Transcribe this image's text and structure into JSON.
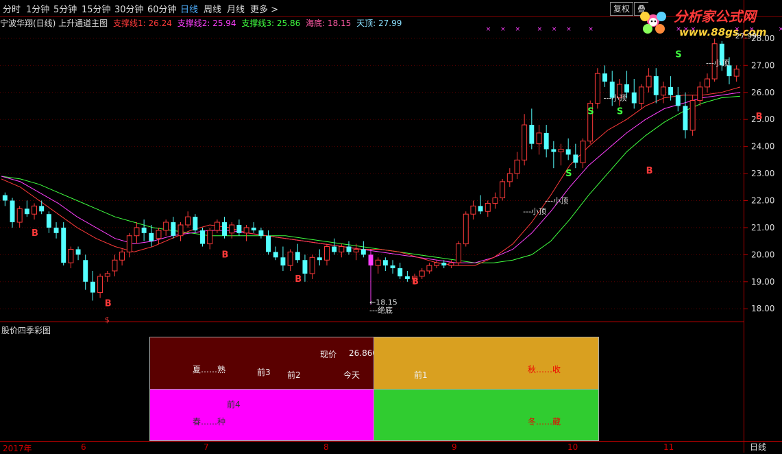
{
  "toolbar": {
    "periods": [
      "分时",
      "1分钟",
      "5分钟",
      "15分钟",
      "30分钟",
      "60分钟",
      "日线",
      "周线",
      "月线",
      "更多 >"
    ],
    "active": "日线",
    "fuquan_label": "复权",
    "cut_label": "叠",
    "logo_text": "分析家公式网",
    "logo_url_text": "www.88gs.com"
  },
  "info": {
    "stock_title": "宁波华翔(日线) 上升通道主图",
    "zc1": "支撑线1: 26.24",
    "zc2": "支撑线2: 25.94",
    "zc3": "支撑线3: 25.86",
    "haidi": "海底: 18.15",
    "tianding": "天顶: 27.99"
  },
  "colors": {
    "up": "#ff3a3a",
    "down": "#54ffff",
    "ma1": "#ff3a3a",
    "ma2": "#ff40ff",
    "ma3": "#40ff40",
    "grid_red": "#b00000"
  },
  "chart_data": {
    "type": "candlestick",
    "ylim": [
      17.6,
      28.2
    ],
    "yticks": [
      "28.00",
      "27.00",
      "26.00",
      "25.00",
      "24.00",
      "23.00",
      "22.00",
      "21.00",
      "20.00",
      "19.00",
      "18.00"
    ],
    "xlabels": [
      "2017年",
      "6",
      "7",
      "8",
      "9",
      "10",
      "11"
    ],
    "ma1": [
      22.8,
      22.5,
      22.0,
      21.5,
      21.0,
      20.6,
      20.3,
      20.1,
      20.3,
      20.6,
      20.9,
      21.1,
      21.0,
      20.8,
      20.7,
      20.6,
      20.5,
      20.4,
      20.3,
      20.2,
      20.2,
      20.1,
      19.9,
      19.7,
      19.6,
      19.6,
      19.9,
      20.4,
      21.2,
      22.2,
      23.3,
      24.0,
      24.6,
      25.0,
      25.5,
      25.8,
      25.9,
      25.9,
      26.0,
      26.2
    ],
    "ma2": [
      22.9,
      22.7,
      22.3,
      21.9,
      21.4,
      21.0,
      20.6,
      20.4,
      20.5,
      20.7,
      20.8,
      20.9,
      20.9,
      20.8,
      20.7,
      20.6,
      20.5,
      20.4,
      20.3,
      20.2,
      20.1,
      20.0,
      19.9,
      19.8,
      19.7,
      19.7,
      19.9,
      20.2,
      20.8,
      21.6,
      22.5,
      23.3,
      23.9,
      24.5,
      25.0,
      25.4,
      25.6,
      25.8,
      25.9,
      26.0
    ],
    "ma3": [
      22.9,
      22.8,
      22.6,
      22.3,
      22.0,
      21.7,
      21.4,
      21.2,
      21.0,
      20.9,
      20.8,
      20.7,
      20.7,
      20.7,
      20.7,
      20.7,
      20.6,
      20.5,
      20.4,
      20.3,
      20.2,
      20.1,
      20.0,
      19.9,
      19.8,
      19.7,
      19.7,
      19.8,
      20.0,
      20.5,
      21.3,
      22.2,
      23.0,
      23.8,
      24.4,
      24.9,
      25.3,
      25.6,
      25.8,
      25.86
    ],
    "candles": [
      [
        22.2,
        22.3,
        21.8,
        22.0
      ],
      [
        22.0,
        22.1,
        21.0,
        21.2
      ],
      [
        21.2,
        21.8,
        21.0,
        21.7
      ],
      [
        21.7,
        22.0,
        21.4,
        21.5
      ],
      [
        21.5,
        21.9,
        21.3,
        21.8
      ],
      [
        21.8,
        22.0,
        21.5,
        21.6
      ],
      [
        21.5,
        21.6,
        20.8,
        21.0
      ],
      [
        21.0,
        21.2,
        20.6,
        20.8
      ],
      [
        21.0,
        21.2,
        19.6,
        19.7
      ],
      [
        19.7,
        20.3,
        19.5,
        20.2
      ],
      [
        20.2,
        20.3,
        19.8,
        20.0
      ],
      [
        19.8,
        20.0,
        18.7,
        19.0
      ],
      [
        19.0,
        19.4,
        18.3,
        18.6
      ],
      [
        18.6,
        19.3,
        18.4,
        19.2
      ],
      [
        19.2,
        19.4,
        19.0,
        19.3
      ],
      [
        19.4,
        20.0,
        19.2,
        19.8
      ],
      [
        19.8,
        20.2,
        19.6,
        20.1
      ],
      [
        20.1,
        20.8,
        19.9,
        20.7
      ],
      [
        20.7,
        21.2,
        20.4,
        21.0
      ],
      [
        21.0,
        21.3,
        20.5,
        20.8
      ],
      [
        20.8,
        21.1,
        20.3,
        20.5
      ],
      [
        20.6,
        21.0,
        20.4,
        20.9
      ],
      [
        20.9,
        21.3,
        20.7,
        21.2
      ],
      [
        21.2,
        21.4,
        20.6,
        20.7
      ],
      [
        20.7,
        21.2,
        20.5,
        21.1
      ],
      [
        21.1,
        21.6,
        21.0,
        21.4
      ],
      [
        21.4,
        21.5,
        20.8,
        20.9
      ],
      [
        20.9,
        21.0,
        20.3,
        20.4
      ],
      [
        20.4,
        21.0,
        20.2,
        20.9
      ],
      [
        20.9,
        21.3,
        20.8,
        21.2
      ],
      [
        21.2,
        21.4,
        20.6,
        20.7
      ],
      [
        20.8,
        21.2,
        20.6,
        21.1
      ],
      [
        21.1,
        21.3,
        20.7,
        20.8
      ],
      [
        20.8,
        21.1,
        20.5,
        21.0
      ],
      [
        21.0,
        21.2,
        20.8,
        20.9
      ],
      [
        20.9,
        21.0,
        20.6,
        20.7
      ],
      [
        20.7,
        20.9,
        20.0,
        20.1
      ],
      [
        20.1,
        20.3,
        19.8,
        19.9
      ],
      [
        19.9,
        20.3,
        19.4,
        19.6
      ],
      [
        19.6,
        20.2,
        19.4,
        20.1
      ],
      [
        20.1,
        20.4,
        19.7,
        19.8
      ],
      [
        19.8,
        20.0,
        19.0,
        19.3
      ],
      [
        19.3,
        20.0,
        19.1,
        19.9
      ],
      [
        19.9,
        20.2,
        19.6,
        19.8
      ],
      [
        19.8,
        20.4,
        19.6,
        20.3
      ],
      [
        20.3,
        20.6,
        20.0,
        20.1
      ],
      [
        20.1,
        20.4,
        19.9,
        20.3
      ],
      [
        20.3,
        20.5,
        20.0,
        20.1
      ],
      [
        20.1,
        20.4,
        19.8,
        20.2
      ],
      [
        20.2,
        20.5,
        19.9,
        20.0
      ],
      [
        20.0,
        20.2,
        18.15,
        19.6
      ],
      [
        19.6,
        19.9,
        19.3,
        19.8
      ],
      [
        19.8,
        19.9,
        19.4,
        19.6
      ],
      [
        19.6,
        19.8,
        19.3,
        19.5
      ],
      [
        19.5,
        19.7,
        19.1,
        19.2
      ],
      [
        19.2,
        19.4,
        19.0,
        19.1
      ],
      [
        19.1,
        19.3,
        18.9,
        19.2
      ],
      [
        19.2,
        19.5,
        19.1,
        19.4
      ],
      [
        19.4,
        19.7,
        19.3,
        19.6
      ],
      [
        19.6,
        19.8,
        19.5,
        19.7
      ],
      [
        19.7,
        19.8,
        19.5,
        19.6
      ],
      [
        19.6,
        19.8,
        19.5,
        19.7
      ],
      [
        19.7,
        20.5,
        19.6,
        20.4
      ],
      [
        20.4,
        21.6,
        20.3,
        21.5
      ],
      [
        21.5,
        22.0,
        21.3,
        21.8
      ],
      [
        21.8,
        22.2,
        21.5,
        21.6
      ],
      [
        21.6,
        22.0,
        21.4,
        21.9
      ],
      [
        21.9,
        22.3,
        21.7,
        22.1
      ],
      [
        22.1,
        22.8,
        22.0,
        22.7
      ],
      [
        22.7,
        23.2,
        22.5,
        23.0
      ],
      [
        23.0,
        23.8,
        22.8,
        23.5
      ],
      [
        23.5,
        25.2,
        23.3,
        24.8
      ],
      [
        24.8,
        25.4,
        23.9,
        24.1
      ],
      [
        24.1,
        24.8,
        23.7,
        24.5
      ],
      [
        24.5,
        24.8,
        23.6,
        23.9
      ],
      [
        23.9,
        24.2,
        23.2,
        23.8
      ],
      [
        23.8,
        24.1,
        23.3,
        23.9
      ],
      [
        23.9,
        24.3,
        23.5,
        23.7
      ],
      [
        23.7,
        24.1,
        23.2,
        23.4
      ],
      [
        23.4,
        24.3,
        23.2,
        24.2
      ],
      [
        24.2,
        25.7,
        24.1,
        25.6
      ],
      [
        25.6,
        26.9,
        25.4,
        26.7
      ],
      [
        26.7,
        27.0,
        26.2,
        26.4
      ],
      [
        26.4,
        26.8,
        25.5,
        25.8
      ],
      [
        25.8,
        26.5,
        25.5,
        26.3
      ],
      [
        26.3,
        26.8,
        25.8,
        26.0
      ],
      [
        26.0,
        26.5,
        25.4,
        25.6
      ],
      [
        25.6,
        26.3,
        25.4,
        26.2
      ],
      [
        26.2,
        26.9,
        26.0,
        26.6
      ],
      [
        26.6,
        26.9,
        25.6,
        25.9
      ],
      [
        25.9,
        26.4,
        25.6,
        26.2
      ],
      [
        26.2,
        26.6,
        25.7,
        25.9
      ],
      [
        25.9,
        26.2,
        25.3,
        25.5
      ],
      [
        25.5,
        26.0,
        24.3,
        24.6
      ],
      [
        24.6,
        25.9,
        24.4,
        25.7
      ],
      [
        25.7,
        26.4,
        25.5,
        26.2
      ],
      [
        26.2,
        26.7,
        26.0,
        26.5
      ],
      [
        26.5,
        27.99,
        26.4,
        27.8
      ],
      [
        27.8,
        27.9,
        26.8,
        27.0
      ],
      [
        27.0,
        27.3,
        26.3,
        26.6
      ],
      [
        26.6,
        27.0,
        26.4,
        26.86
      ]
    ],
    "signals": [
      {
        "text": "B",
        "color": "#ff3a3a",
        "i": 4,
        "price": 20.7
      },
      {
        "text": "B",
        "color": "#ff3a3a",
        "i": 14,
        "price": 18.1
      },
      {
        "text": "B",
        "color": "#ff3a3a",
        "i": 30,
        "price": 19.9
      },
      {
        "text": "B",
        "color": "#ff3a3a",
        "i": 40,
        "price": 19.0
      },
      {
        "text": "B",
        "color": "#ff3a3a",
        "i": 56,
        "price": 18.9
      },
      {
        "text": "S",
        "color": "#40ff40",
        "i": 77,
        "price": 22.9
      },
      {
        "text": "S",
        "color": "#40ff40",
        "i": 80,
        "price": 25.2
      },
      {
        "text": "S",
        "color": "#40ff40",
        "i": 84,
        "price": 25.2
      },
      {
        "text": "B",
        "color": "#ff3a3a",
        "i": 88,
        "price": 23.0
      },
      {
        "text": "S",
        "color": "#40ff40",
        "i": 92,
        "price": 27.3
      },
      {
        "text": "B",
        "color": "#ff3a3a",
        "i": 103,
        "price": 25.0
      }
    ],
    "annotations": [
      {
        "text": "←18.15",
        "i": 50,
        "price": 18.15
      },
      {
        "text": "---绝底",
        "i": 50,
        "price": 17.85
      },
      {
        "text": "27.99",
        "i": 100,
        "price": 28.0
      },
      {
        "text": "---小顶",
        "i": 96,
        "price": 27.0
      },
      {
        "text": "---小顶",
        "i": 82,
        "price": 25.7
      },
      {
        "text": "---小顶",
        "i": 74,
        "price": 21.9
      },
      {
        "text": "---小顶",
        "i": 71,
        "price": 21.5
      }
    ],
    "markers_x": [
      66,
      68,
      70,
      73,
      75,
      77,
      80,
      92,
      93,
      94,
      100,
      102,
      106,
      108
    ]
  },
  "bottom": {
    "title": "股价四季彩图",
    "price_label": "现价",
    "price_value": "26.860",
    "today": "今天",
    "q1": "前1",
    "q2": "前2",
    "q3": "前3",
    "q4": "前4",
    "summer": "夏……熟",
    "autumn": "秋……收",
    "spring": "春……种",
    "winter": "冬……藏"
  },
  "period_tab": "日线"
}
